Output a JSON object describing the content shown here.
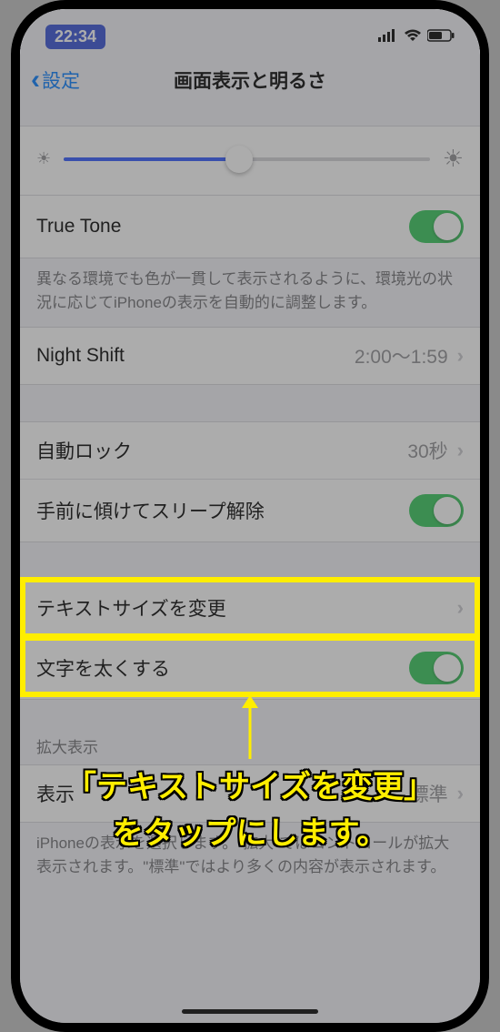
{
  "status": {
    "time": "22:34"
  },
  "nav": {
    "back": "設定",
    "title": "画面表示と明るさ"
  },
  "rows": {
    "true_tone": "True Tone",
    "true_tone_desc": "異なる環境でも色が一貫して表示されるように、環境光の状況に応じてiPhoneの表示を自動的に調整します。",
    "night_shift": "Night Shift",
    "night_shift_value": "2:00〜1:59",
    "auto_lock": "自動ロック",
    "auto_lock_value": "30秒",
    "raise_to_wake": "手前に傾けてスリープ解除",
    "text_size": "テキストサイズを変更",
    "bold_text": "文字を太くする",
    "zoom_header": "拡大表示",
    "display": "表示",
    "display_value": "標準",
    "display_desc": "iPhoneの表示を選択します。\"拡大\"ではコントロールが拡大表示されます。\"標準\"ではより多くの内容が表示されます。"
  },
  "annotation": {
    "line1": "「テキストサイズを変更」",
    "line2": "をタップにします。"
  }
}
